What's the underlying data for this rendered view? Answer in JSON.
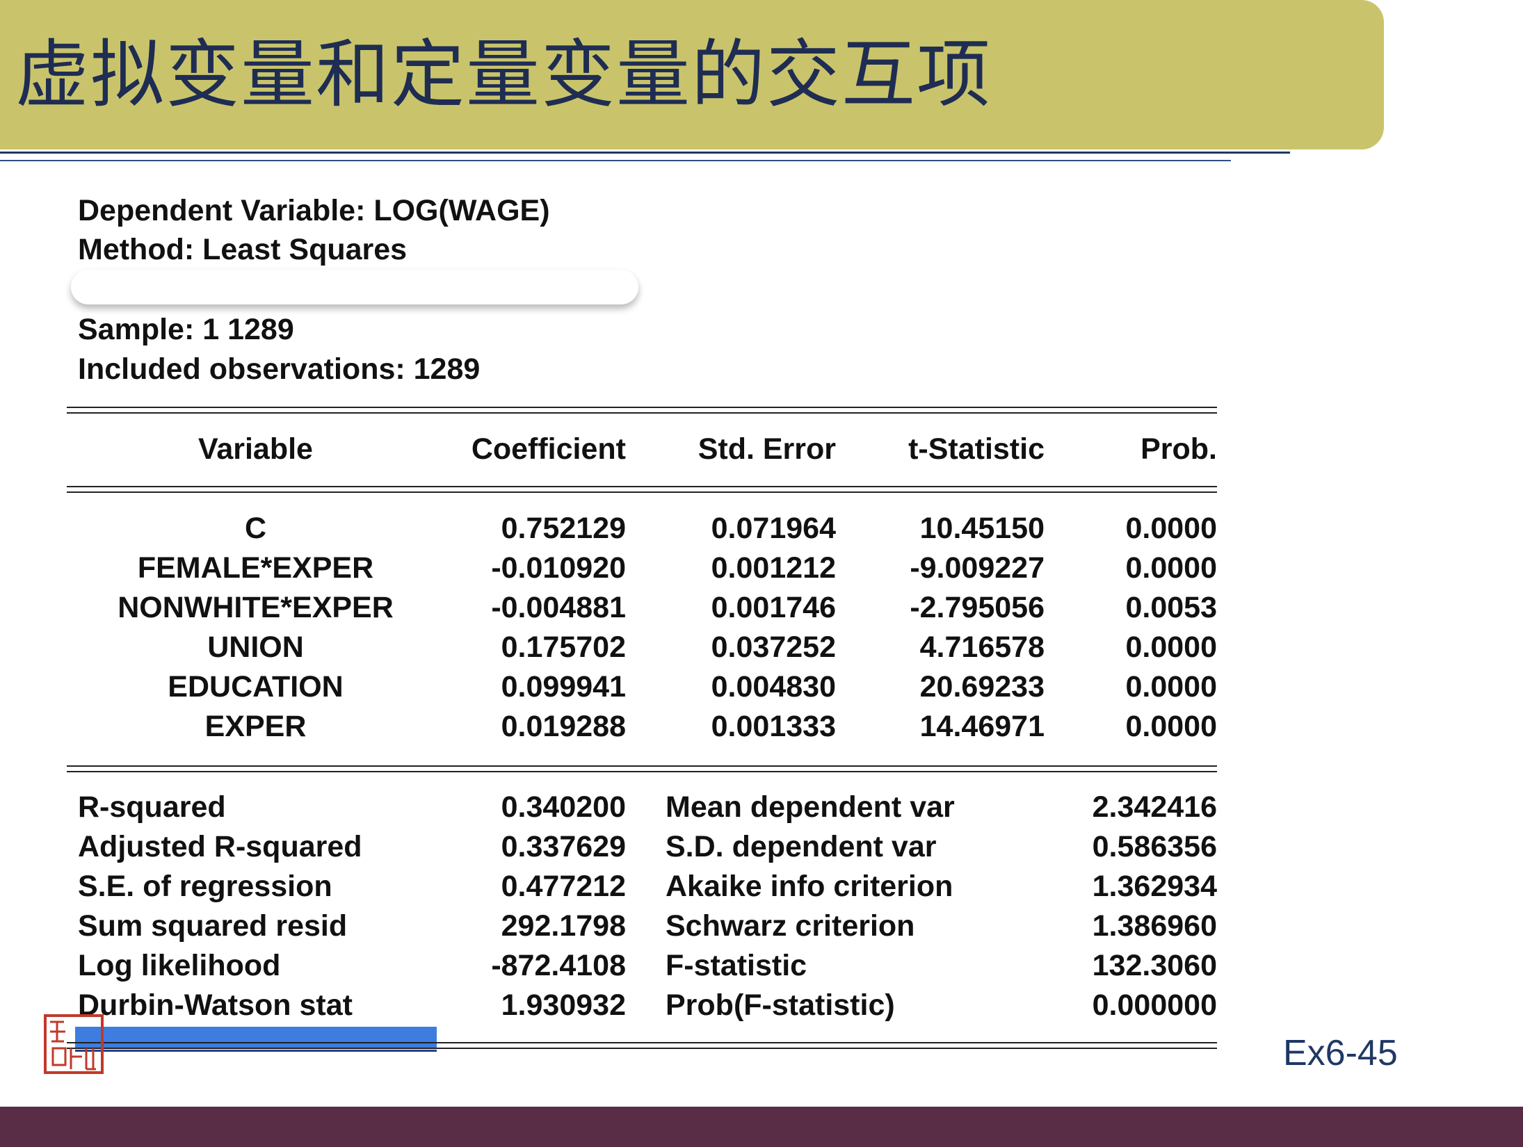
{
  "title": "虚拟变量和定量变量的交互项",
  "header": {
    "dependent": "Dependent Variable: LOG(WAGE)",
    "method": "Method: Least Squares",
    "sample": "Sample: 1 1289",
    "observations": "Included observations: 1289"
  },
  "table": {
    "columns": [
      "Variable",
      "Coefficient",
      "Std. Error",
      "t-Statistic",
      "Prob."
    ],
    "rows": [
      [
        "C",
        "0.752129",
        "0.071964",
        "10.45150",
        "0.0000"
      ],
      [
        "FEMALE*EXPER",
        "-0.010920",
        "0.001212",
        "-9.009227",
        "0.0000"
      ],
      [
        "NONWHITE*EXPER",
        "-0.004881",
        "0.001746",
        "-2.795056",
        "0.0053"
      ],
      [
        "UNION",
        "0.175702",
        "0.037252",
        "4.716578",
        "0.0000"
      ],
      [
        "EDUCATION",
        "0.099941",
        "0.004830",
        "20.69233",
        "0.0000"
      ],
      [
        "EXPER",
        "0.019288",
        "0.001333",
        "14.46971",
        "0.0000"
      ]
    ]
  },
  "stats": [
    [
      "R-squared",
      "0.340200",
      "Mean dependent var",
      "2.342416"
    ],
    [
      "Adjusted R-squared",
      "0.337629",
      "S.D. dependent var",
      "0.586356"
    ],
    [
      "S.E. of regression",
      "0.477212",
      "Akaike info criterion",
      "1.362934"
    ],
    [
      "Sum squared resid",
      "292.1798",
      "Schwarz criterion",
      "1.386960"
    ],
    [
      "Log likelihood",
      "-872.4108",
      "F-statistic",
      "132.3060"
    ],
    [
      "Durbin-Watson stat",
      "1.930932",
      "Prob(F-statistic)",
      "0.000000"
    ]
  ],
  "slide_ref": "Ex6-45",
  "colors": {
    "title_bar": "#c9c46b",
    "title_text": "#1f2d53",
    "footer": "#5a2d47",
    "highlight": "#3d7de0",
    "seal": "#c0392b"
  },
  "icons": {
    "seal": "seal-stamp-icon"
  }
}
